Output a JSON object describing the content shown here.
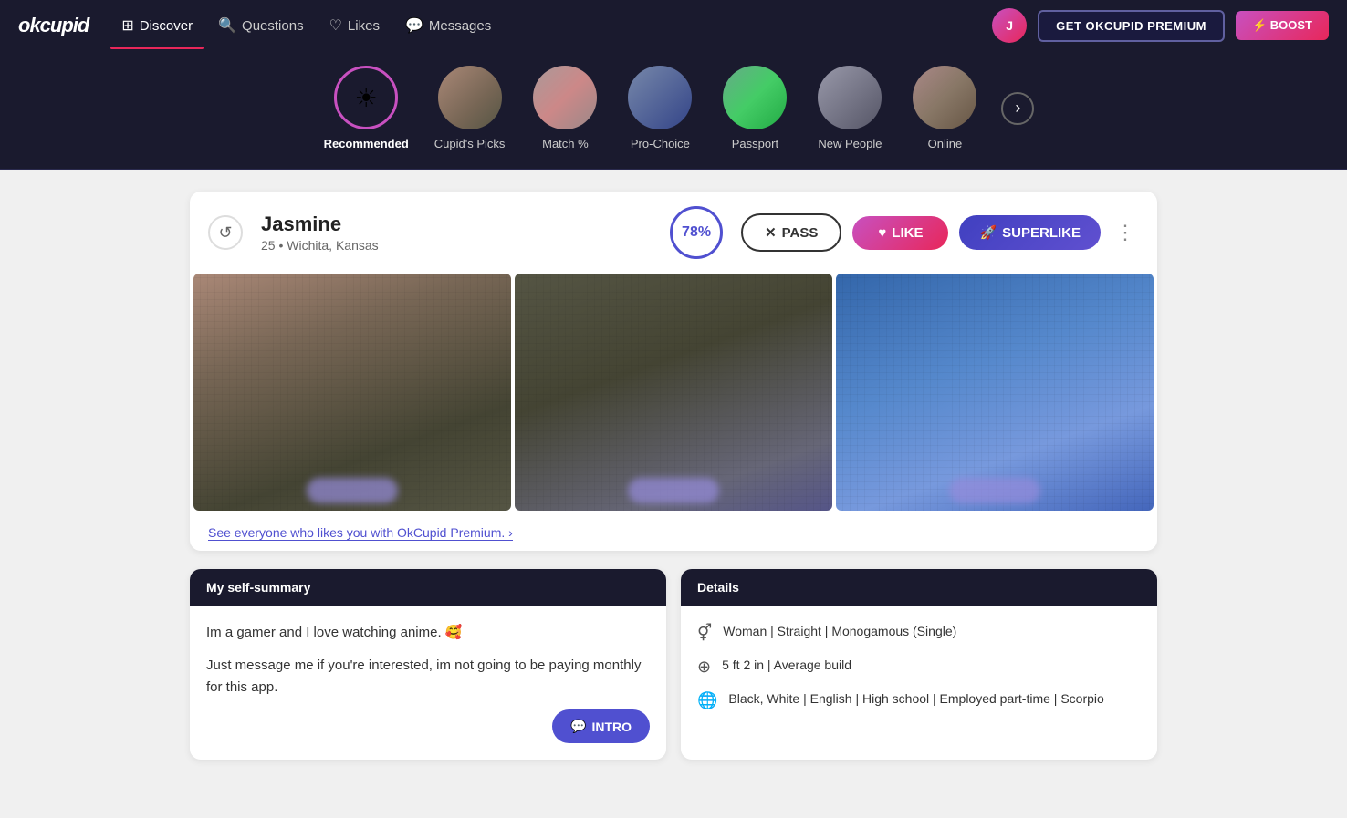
{
  "app": {
    "logo": "okcupid",
    "premium_btn": "GET OKCUPID PREMIUM",
    "boost_btn": "⚡ BOOST"
  },
  "navbar": {
    "items": [
      {
        "label": "Discover",
        "icon": "⊞",
        "active": true
      },
      {
        "label": "Questions",
        "icon": "🔍"
      },
      {
        "label": "Likes",
        "icon": "♡"
      },
      {
        "label": "Messages",
        "icon": "💬"
      }
    ]
  },
  "categories": {
    "items": [
      {
        "label": "Recommended",
        "active": true,
        "icon_type": "sun"
      },
      {
        "label": "Cupid's Picks",
        "thumb_class": "ct-1"
      },
      {
        "label": "Match %",
        "thumb_class": "ct-2"
      },
      {
        "label": "Pro-Choice",
        "thumb_class": "ct-3"
      },
      {
        "label": "Passport",
        "thumb_class": "ct-4"
      },
      {
        "label": "New People",
        "thumb_class": "ct-5"
      },
      {
        "label": "Online",
        "thumb_class": "ct-6"
      }
    ],
    "next_btn": "›"
  },
  "profile": {
    "name": "Jasmine",
    "age": "25",
    "location": "Wichita, Kansas",
    "match_pct": "78%",
    "pass_btn": "PASS",
    "like_btn": "LIKE",
    "superlike_btn": "SUPERLIKE",
    "premium_cta": "See everyone who likes you with OkCupid Premium. ›"
  },
  "summary": {
    "header": "My self-summary",
    "text1": "Im a gamer and I love watching anime. 🥰",
    "text2": "Just message me if you're interested, im not going to be paying monthly for this app.",
    "intro_btn": "INTRO"
  },
  "details": {
    "header": "Details",
    "rows": [
      {
        "icon": "⊗",
        "text": "Woman | Straight | Monogamous (Single)"
      },
      {
        "icon": "⊕",
        "text": "5 ft 2 in | Average build"
      },
      {
        "icon": "⊘",
        "text": "Black, White | English | High school | Employed part-time | Scorpio"
      }
    ]
  }
}
